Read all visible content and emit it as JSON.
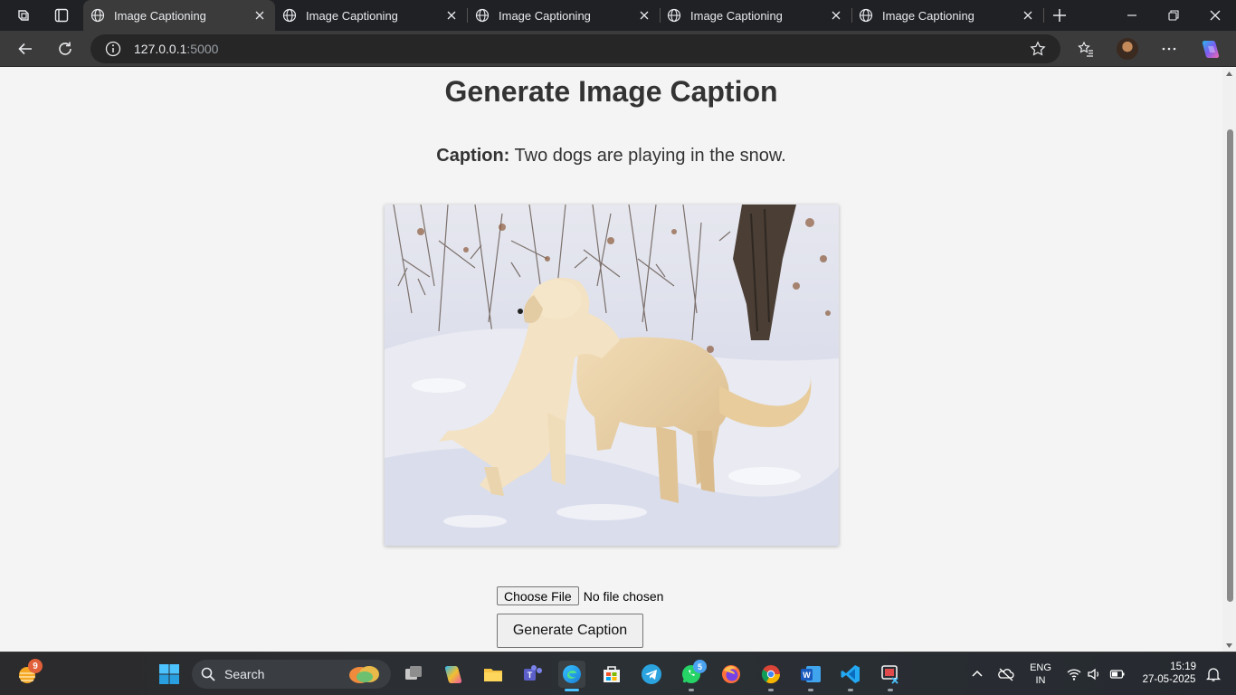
{
  "browser": {
    "tabs": [
      {
        "title": "Image Captioning",
        "active": true
      },
      {
        "title": "Image Captioning",
        "active": false
      },
      {
        "title": "Image Captioning",
        "active": false
      },
      {
        "title": "Image Captioning",
        "active": false
      },
      {
        "title": "Image Captioning",
        "active": false
      }
    ],
    "address": {
      "host": "127.0.0.1",
      "port": ":5000"
    }
  },
  "page": {
    "heading": "Generate Image Caption",
    "caption_label": "Caption:",
    "caption_text": " Two dogs are playing in the snow.",
    "image_alt": "Two dogs playing in the snow",
    "file_input": {
      "button_label": "Choose File",
      "status": "No file chosen"
    },
    "generate_button": "Generate Caption"
  },
  "taskbar": {
    "search_placeholder": "Search",
    "weather_badge": "9",
    "whatsapp_badge": "5",
    "language": "ENG",
    "region": "IN",
    "time": "15:19",
    "date": "27-05-2025",
    "apps": [
      "start-icon",
      "file-explorer-icon",
      "copilot-icon",
      "folder-icon",
      "teams-icon",
      "edge-icon",
      "microsoft-store-icon",
      "telegram-icon",
      "whatsapp-icon",
      "firefox-icon",
      "chrome-icon",
      "word-icon",
      "vscode-icon",
      "snipping-tool-icon"
    ]
  },
  "colors": {
    "accent": "#4cc2ff",
    "page_background": "#f4f4f4",
    "heading": "#333333"
  }
}
